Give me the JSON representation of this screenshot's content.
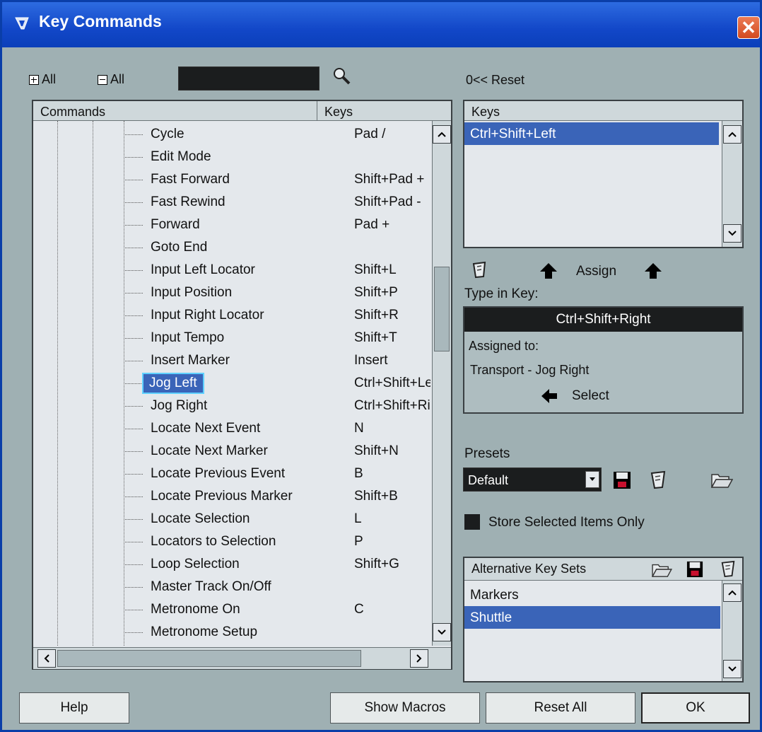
{
  "window": {
    "title": "Key Commands",
    "close_label": "✕"
  },
  "toolbar": {
    "expand_all": "All",
    "collapse_all": "All",
    "search_value": ""
  },
  "commands_table": {
    "headers": {
      "commands": "Commands",
      "keys": "Keys"
    },
    "rows": [
      {
        "name": "Cycle",
        "keys": "Pad /"
      },
      {
        "name": "Edit Mode",
        "keys": ""
      },
      {
        "name": "Fast Forward",
        "keys": "Shift+Pad +"
      },
      {
        "name": "Fast Rewind",
        "keys": "Shift+Pad -"
      },
      {
        "name": "Forward",
        "keys": "Pad +"
      },
      {
        "name": "Goto End",
        "keys": ""
      },
      {
        "name": "Input Left Locator",
        "keys": "Shift+L"
      },
      {
        "name": "Input Position",
        "keys": "Shift+P"
      },
      {
        "name": "Input Right Locator",
        "keys": "Shift+R"
      },
      {
        "name": "Input Tempo",
        "keys": "Shift+T"
      },
      {
        "name": "Insert Marker",
        "keys": "Insert"
      },
      {
        "name": "Jog Left",
        "keys": "Ctrl+Shift+Left",
        "selected": true
      },
      {
        "name": "Jog Right",
        "keys": "Ctrl+Shift+Right"
      },
      {
        "name": "Locate Next Event",
        "keys": "N"
      },
      {
        "name": "Locate Next Marker",
        "keys": "Shift+N"
      },
      {
        "name": "Locate Previous Event",
        "keys": "B"
      },
      {
        "name": "Locate Previous Marker",
        "keys": "Shift+B"
      },
      {
        "name": "Locate Selection",
        "keys": "L"
      },
      {
        "name": "Locators to Selection",
        "keys": "P"
      },
      {
        "name": "Loop Selection",
        "keys": "Shift+G"
      },
      {
        "name": "Master Track On/Off",
        "keys": ""
      },
      {
        "name": "Metronome On",
        "keys": "C"
      },
      {
        "name": "Metronome Setup",
        "keys": ""
      }
    ]
  },
  "right_panel": {
    "reset_label": "0<< Reset",
    "keys_header": "Keys",
    "assigned_keys": [
      "Ctrl+Shift+Left"
    ],
    "assign_label": "Assign",
    "type_in_key_label": "Type in Key:",
    "type_in_key_value": "Ctrl+Shift+Right",
    "assigned_to_label": "Assigned to:",
    "assigned_to_value": "Transport - Jog Right",
    "select_label": "Select",
    "presets_label": "Presets",
    "presets_value": "Default",
    "store_selected_label": "Store Selected Items Only",
    "alt_key_sets_header": "Alternative Key Sets",
    "alt_key_sets": [
      "Markers",
      "Shuttle"
    ],
    "alt_key_sets_selected": 1
  },
  "buttons": {
    "help": "Help",
    "show_macros": "Show Macros",
    "reset_all": "Reset All",
    "ok": "OK"
  }
}
